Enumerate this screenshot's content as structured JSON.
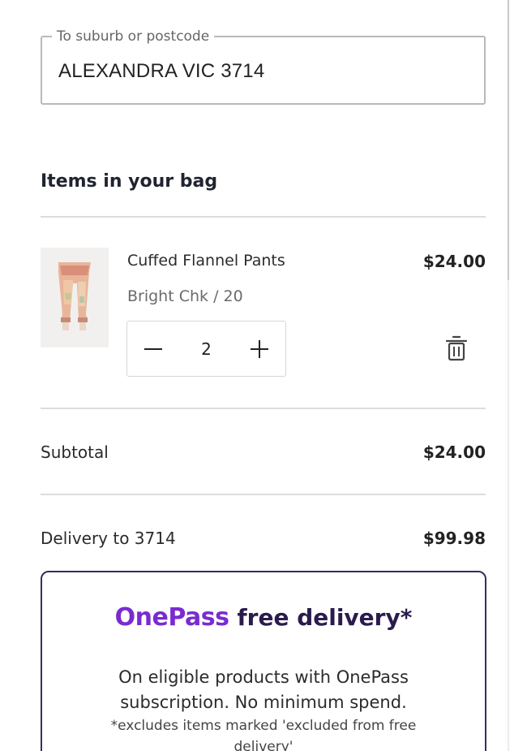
{
  "delivery_field": {
    "legend": "To suburb or postcode",
    "value": "ALEXANDRA VIC 3714"
  },
  "bag": {
    "title": "Items in your bag",
    "items": [
      {
        "name": "Cuffed Flannel Pants",
        "variant": "Bright Chk / 20",
        "price": "$24.00",
        "quantity": "2",
        "image_icon": "product-thumbnail"
      }
    ]
  },
  "summary": {
    "subtotal_label": "Subtotal",
    "subtotal_value": "$24.00",
    "delivery_label": "Delivery to 3714",
    "delivery_value": "$99.98"
  },
  "onepass": {
    "logo": "OnePass",
    "headline": "free delivery*",
    "body": "On eligible products with OnePass subscription. No minimum spend.",
    "fine_print": "*excludes items marked 'excluded from free delivery'",
    "colors": {
      "brand": "#7a2bd0",
      "border": "#3d2a63",
      "heading": "#2b1b4d"
    }
  },
  "icons": {
    "minus": "minus-icon",
    "plus": "plus-icon",
    "remove": "trash-icon"
  }
}
